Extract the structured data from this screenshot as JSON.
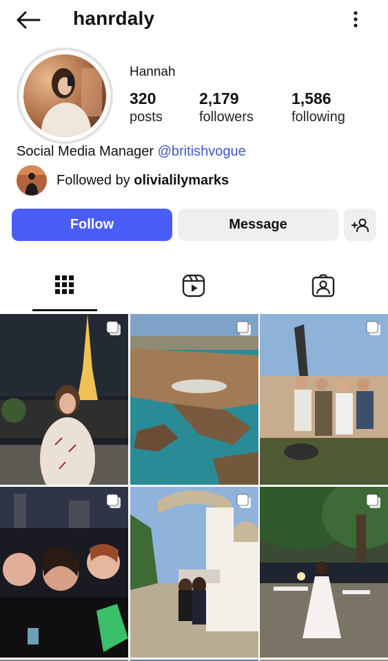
{
  "header": {
    "username": "hanrdaly",
    "back_icon": "arrow-left-icon",
    "more_icon": "more-vertical-icon"
  },
  "profile": {
    "display_name": "Hannah",
    "stats": [
      {
        "value": "320",
        "label": "posts"
      },
      {
        "value": "2,179",
        "label": "followers"
      },
      {
        "value": "1,586",
        "label": "following"
      }
    ],
    "bio_text": "Social Media Manager ",
    "bio_mention": "@britishvogue",
    "followed_by_prefix": "Followed by ",
    "followed_by_user": "olivialilymarks"
  },
  "actions": {
    "follow_label": "Follow",
    "message_label": "Message",
    "add_user_icon": "add-user-icon"
  },
  "tabs": [
    {
      "icon": "grid-icon",
      "active": true
    },
    {
      "icon": "reels-icon",
      "active": false
    },
    {
      "icon": "tagged-icon",
      "active": false
    }
  ],
  "colors": {
    "accent": "#4a5df9",
    "mention": "#3b58c9",
    "secondary_button": "#efeff1"
  }
}
